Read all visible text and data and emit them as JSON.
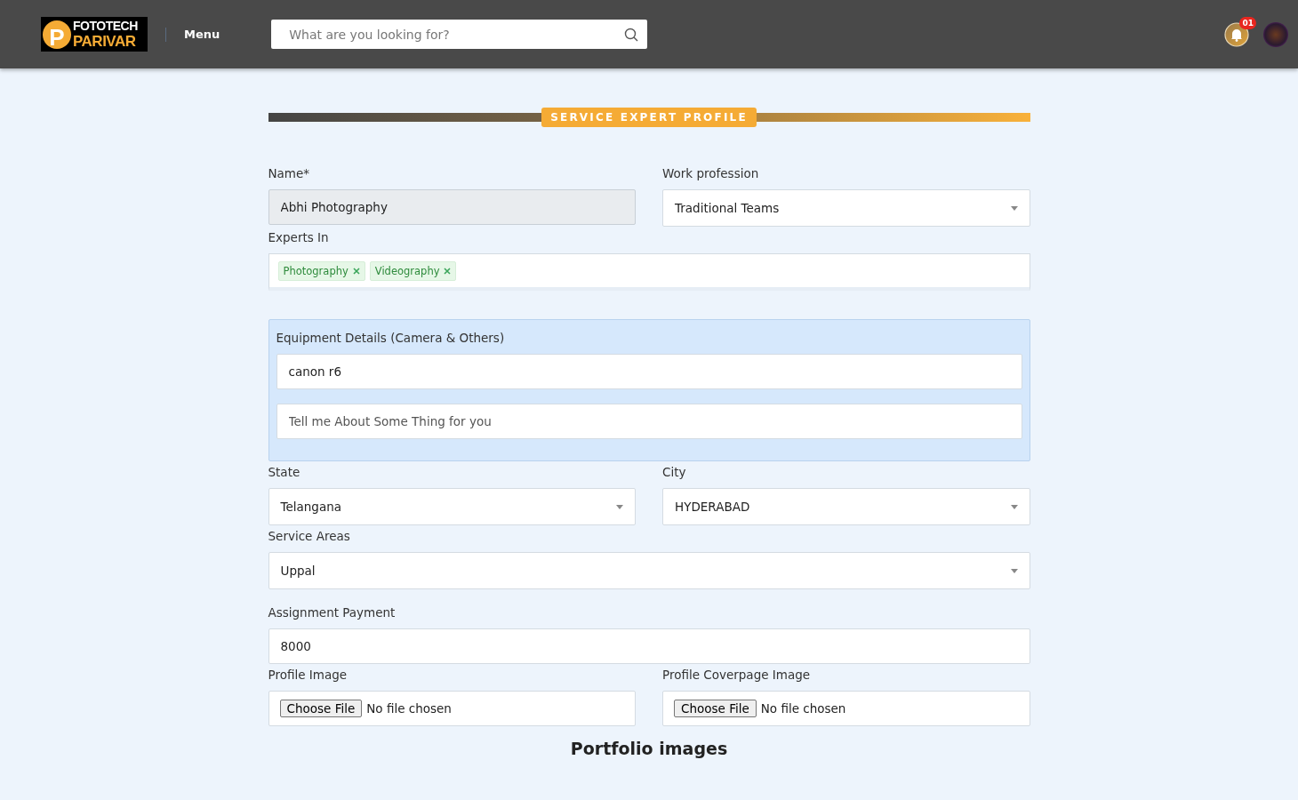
{
  "header": {
    "logo": {
      "mark": "P",
      "line_1": "FOTOTECH",
      "line_2": "PARIVAR"
    },
    "menu": "Menu",
    "search": {
      "placeholder": "What are you looking for?"
    },
    "notifications": {
      "count": "01"
    }
  },
  "section_title": "SERVICE EXPERT PROFILE",
  "name": {
    "label": "Name*",
    "value": "Abhi Photography",
    "disabled": true
  },
  "work_profession": {
    "label": "Work profession",
    "value": "Traditional Teams"
  },
  "experts_in": {
    "label": "Experts In",
    "tags": [
      "Photography",
      "Videography"
    ]
  },
  "equipment": {
    "label": "Equipment Details (Camera & Others)",
    "value": "canon r6",
    "about_placeholder": "Tell me About Some Thing for you"
  },
  "state": {
    "label": "State",
    "value": "Telangana"
  },
  "city": {
    "label": "City",
    "value": "HYDERABAD"
  },
  "service_areas": {
    "label": "Service Areas",
    "value": "Uppal"
  },
  "assignment_payment": {
    "label": "Assignment Payment",
    "value": "8000"
  },
  "profile_image": {
    "label": "Profile Image",
    "button": "Choose File",
    "status": "No file chosen"
  },
  "coverpage_image": {
    "label": "Profile Coverpage Image",
    "button": "Choose File",
    "status": "No file chosen"
  },
  "portfolio_heading": "Portfolio images"
}
